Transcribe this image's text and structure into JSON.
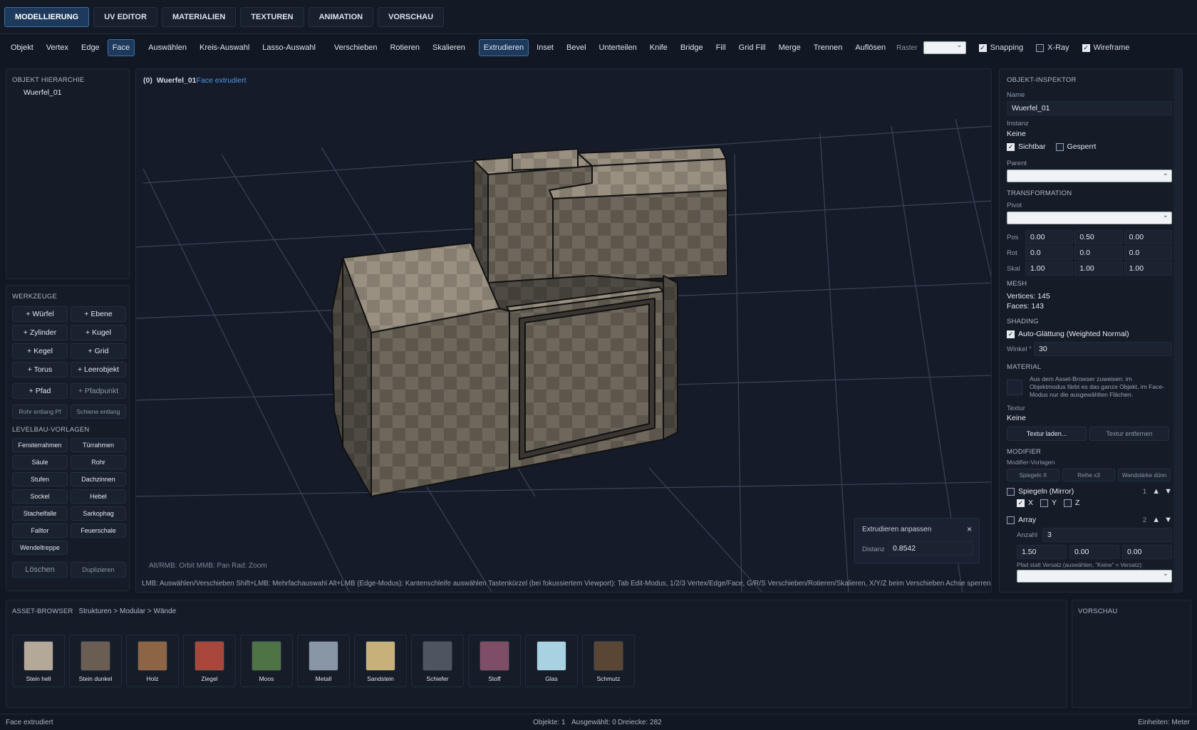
{
  "tabs": [
    "MODELLIERUNG",
    "UV EDITOR",
    "MATERIALIEN",
    "TEXTUREN",
    "ANIMATION",
    "VORSCHAU"
  ],
  "toolbar": {
    "modes": [
      "Objekt",
      "Vertex",
      "Edge",
      "Face"
    ],
    "select": [
      "Auswählen",
      "Kreis-Auswahl",
      "Lasso-Auswahl"
    ],
    "transform": [
      "Verschieben",
      "Rotieren",
      "Skalieren"
    ],
    "ops": [
      "Extrudieren",
      "Inset",
      "Bevel",
      "Unterteilen",
      "Knife",
      "Bridge",
      "Fill",
      "Grid Fill",
      "Merge",
      "Trennen",
      "Auflösen"
    ],
    "raster_label": "Raster",
    "snapping": "Snapping",
    "xray": "X-Ray",
    "wireframe": "Wireframe"
  },
  "hierarchy": {
    "title": "OBJEKT HIERARCHIE",
    "item": "Wuerfel_01"
  },
  "tools": {
    "title": "WERKZEUGE",
    "buttons": [
      "+ Würfel",
      "+ Ebene",
      "+ Zylinder",
      "+ Kugel",
      "+ Kegel",
      "+ Grid",
      "+ Torus",
      "+ Leerobjekt",
      "+ Pfad",
      "+ Pfadpunkt",
      "Rohr entlang Pf",
      "Schiene entlang"
    ],
    "level_title": "LEVELBAU-VORLAGEN",
    "level": [
      "Fensterrahmen",
      "Türrahmen",
      "Säule",
      "Rohr",
      "Stufen",
      "Dachzinnen",
      "Sockel",
      "Hebel",
      "Stachelfalle",
      "Sarkophag",
      "Falltor",
      "Feuerschale",
      "Wendeltreppe"
    ],
    "delete": "Löschen",
    "duplicate": "Duplizieren"
  },
  "viewport": {
    "index": "(0)",
    "object": "Wuerfel_01",
    "action": "Face extrudiert",
    "nav_hint": "Alt/RMB: Orbit   MMB: Pan   Rad: Zoom",
    "help": "LMB: Auswählen/Verschieben   Shift+LMB: Mehrfachauswahl   Alt+LMB (Edge-Modus): Kantenschleife auswählen   Tastenkürzel (bei fokussiertem Viewport): Tab Edit-Modus, 1/2/3 Vertex/Edge/Face, G/R/S Verschieben/Rotieren/Skalieren, X/Y/Z beim Verschieben Achse sperren, E Extrude, I Inse",
    "extrude_panel": {
      "title": "Extrudieren anpassen",
      "dist_label": "Distanz",
      "dist_value": "0.8542"
    }
  },
  "inspector": {
    "title": "OBJEKT-INSPEKTOR",
    "name_label": "Name",
    "name": "Wuerfel_01",
    "instance_label": "Instanz",
    "instance": "Keine",
    "visible": "Sichtbar",
    "locked": "Gesperrt",
    "parent_label": "Parent",
    "transform_title": "TRANSFORMATION",
    "pivot_label": "Pivot",
    "pos_label": "Pos",
    "pos": [
      "0.00",
      "0.50",
      "0.00"
    ],
    "rot_label": "Rot",
    "rot": [
      "0.0",
      "0.0",
      "0.0"
    ],
    "scale_label": "Skal",
    "scale": [
      "1.00",
      "1.00",
      "1.00"
    ],
    "mesh_title": "MESH",
    "vertices": "Vertices: 145",
    "faces": "Faces: 143",
    "shading_title": "SHADING",
    "autosmooth": "Auto-Glättung (Weighted Normal)",
    "angle_label": "Winkel °",
    "angle": "30",
    "material_title": "MATERIAL",
    "material_hint": "Aus dem Asset-Browser zuweisen: im Objektmodus färbt es das ganze Objekt, im Face-Modus nur die ausgewählten Flächen.",
    "texture_label": "Textur",
    "texture": "Keine",
    "load_texture": "Textur laden...",
    "remove_texture": "Textur entfernen",
    "modifier_title": "MODIFIER",
    "modifier_templates": "Modifier-Vorlagen",
    "templates": [
      "Spiegeln X",
      "Reihe x3",
      "Wandstärke dünn"
    ],
    "mirror": "Spiegeln (Mirror)",
    "mirror_idx": "1",
    "axes": [
      "X",
      "Y",
      "Z"
    ],
    "array": "Array",
    "array_idx": "2",
    "count_label": "Anzahl",
    "count": "3",
    "offset": [
      "1.50",
      "0.00",
      "0.00"
    ],
    "path_label": "Pfad statt Versatz (auswählen, \"Keine\" = Versatz):"
  },
  "assets": {
    "title": "ASSET-BROWSER",
    "path": "Strukturen > Modular > Wände",
    "items": [
      {
        "name": "Stein hell",
        "color": "#b4a898"
      },
      {
        "name": "Stein dunkel",
        "color": "#6a5e52"
      },
      {
        "name": "Holz",
        "color": "#8d6444"
      },
      {
        "name": "Ziegel",
        "color": "#a8483c"
      },
      {
        "name": "Moos",
        "color": "#4e7446"
      },
      {
        "name": "Metall",
        "color": "#8896a6"
      },
      {
        "name": "Sandstein",
        "color": "#c8b07a"
      },
      {
        "name": "Schiefer",
        "color": "#4c5560"
      },
      {
        "name": "Stoff",
        "color": "#7e4e66"
      },
      {
        "name": "Glas",
        "color": "#a8d2e2"
      },
      {
        "name": "Schmutz",
        "color": "#5a4634"
      }
    ]
  },
  "preview": {
    "title": "VORSCHAU"
  },
  "status": {
    "left": "Face extrudiert",
    "objects": "Objekte: 1",
    "selected": "Ausgewählt: 0",
    "tris": "Dreiecke: 282",
    "units": "Einheiten: Meter"
  }
}
